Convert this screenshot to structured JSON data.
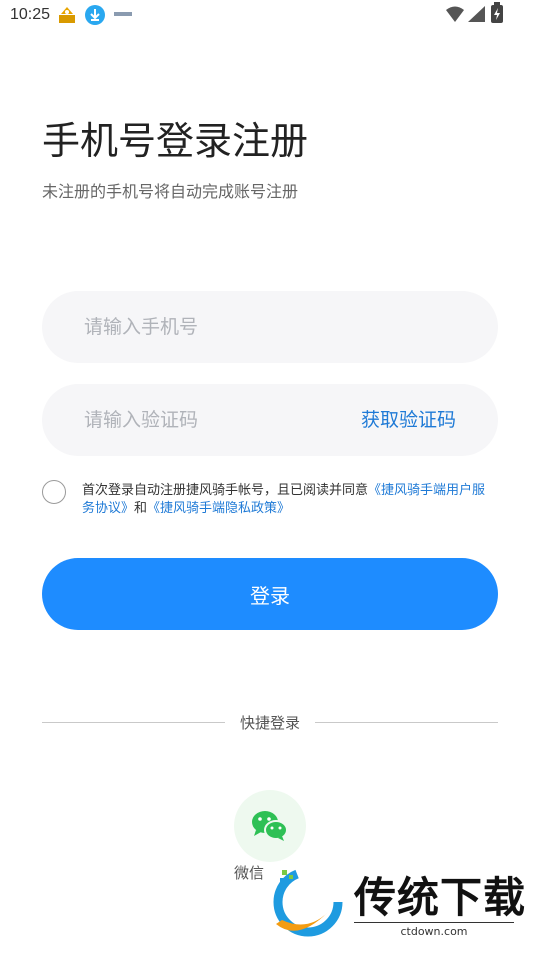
{
  "status_bar": {
    "time": "10:25"
  },
  "page": {
    "title": "手机号登录注册",
    "subtitle": "未注册的手机号将自动完成账号注册"
  },
  "phone": {
    "placeholder": "请输入手机号",
    "value": ""
  },
  "code": {
    "placeholder": "请输入验证码",
    "value": "",
    "get_code_label": "获取验证码"
  },
  "agreement": {
    "checked": false,
    "prefix": "首次登录自动注册捷风骑手帐号，且已阅读并同意",
    "user_agreement_link": "《捷风骑手端用户服务协议》",
    "conjunction": "和",
    "privacy_link": "《捷风骑手端隐私政策》"
  },
  "login_button": {
    "label": "登录"
  },
  "quick_login": {
    "label": "快捷登录",
    "wechat_label": "微信"
  },
  "watermark": {
    "brand": "传统下载",
    "domain": "ctdown.com"
  },
  "colors": {
    "accent": "#1e8cff",
    "link": "#1f7ad6",
    "wechat": "#2ec055"
  }
}
